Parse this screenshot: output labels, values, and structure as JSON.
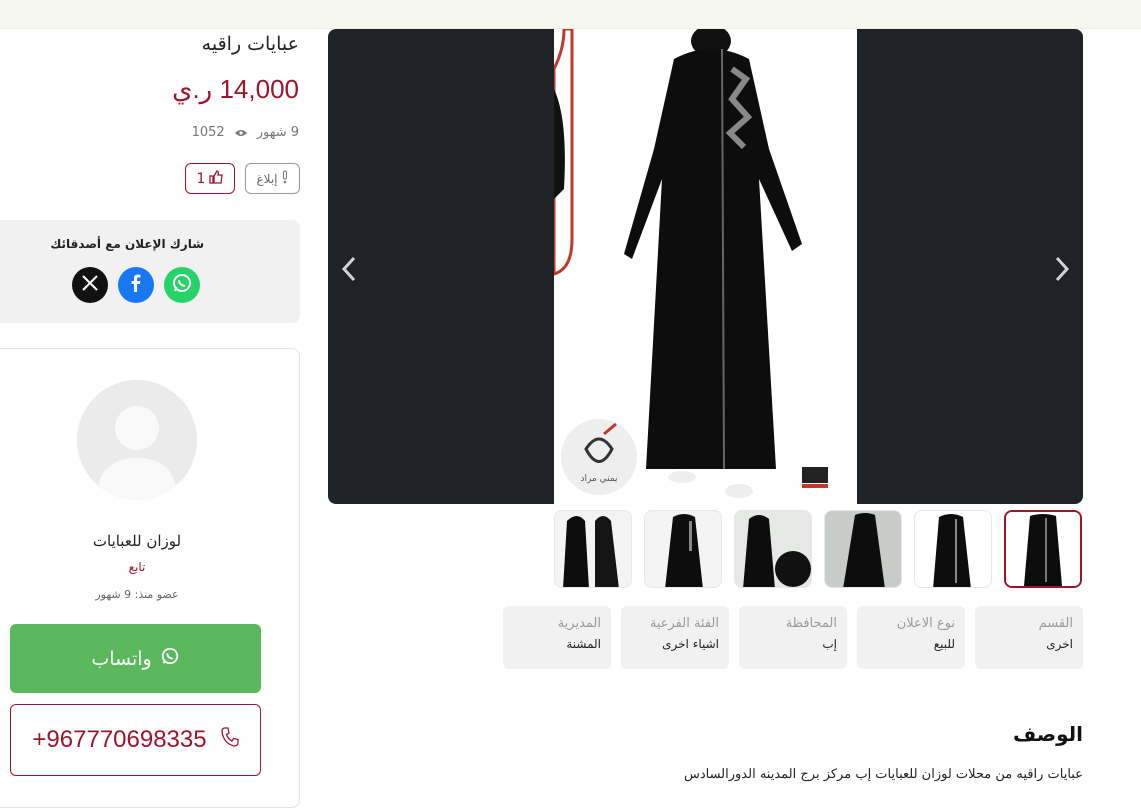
{
  "listing": {
    "title": "عبايات راقيه",
    "price": "14,000 ر.ي",
    "age": "9 شهور",
    "views": "1052",
    "likes": "1",
    "report_label": "إبلاغ"
  },
  "share": {
    "title": "شارك الإعلان مع أصدقائك",
    "networks": [
      "whatsapp-icon",
      "facebook-icon",
      "x-icon"
    ]
  },
  "seller": {
    "name": "لوزان للعبايات",
    "follow_label": "تابع",
    "member_since": "عضو منذ: 9 شهور"
  },
  "contact": {
    "whatsapp_label": "واتساب",
    "phone": "+967770698335"
  },
  "details": [
    {
      "label": "القسم",
      "value": "اخرى"
    },
    {
      "label": "نوع الاعلان",
      "value": "للبيع"
    },
    {
      "label": "المحافظة",
      "value": "إب"
    },
    {
      "label": "الفئة الفرعية",
      "value": "اشياء اخرى"
    },
    {
      "label": "المديرية",
      "value": "المشنة"
    }
  ],
  "description": {
    "title": "الوصف",
    "text": "عبايات راقيه من محلات لوزان للعبايات إب مركز برج المدينه الدورالسادس"
  },
  "gallery": {
    "watermark_text": "يمني مراد",
    "thumbnail_count": 6,
    "active_index": 0
  },
  "colors": {
    "accent": "#a01428",
    "whatsapp": "#5cb85c",
    "facebook": "#1877f2",
    "gallery_bg": "#1f2328"
  }
}
